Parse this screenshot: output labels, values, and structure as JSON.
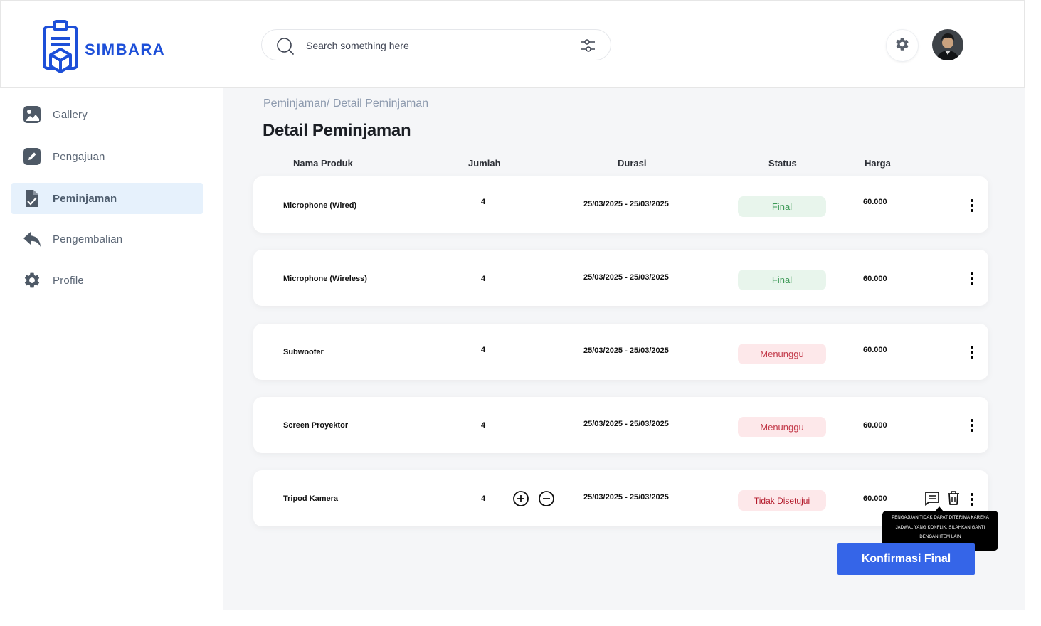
{
  "app": {
    "name": "SIMBARA"
  },
  "search": {
    "placeholder": "Search something here"
  },
  "sidebar": {
    "items": [
      {
        "label": "Gallery",
        "icon": "image-icon"
      },
      {
        "label": "Pengajuan",
        "icon": "edit-icon"
      },
      {
        "label": "Peminjaman",
        "icon": "document-check-icon",
        "active": true
      },
      {
        "label": "Pengembalian",
        "icon": "reply-icon"
      },
      {
        "label": "Profile",
        "icon": "gear-icon"
      }
    ]
  },
  "main": {
    "breadcrumb": "Peminjaman/ Detail Peminjaman",
    "title": "Detail Peminjaman",
    "columns": {
      "name": "Nama Produk",
      "qty": "Jumlah",
      "duration": "Durasi",
      "status": "Status",
      "price": "Harga"
    },
    "rows": [
      {
        "name": "Microphone (Wired)",
        "qty": "4",
        "duration": "25/03/2025 - 25/03/2025",
        "status": "Final",
        "price": "60.000"
      },
      {
        "name": "Microphone (Wireless)",
        "qty": "4",
        "duration": "25/03/2025 - 25/03/2025",
        "status": "Final",
        "price": "60.000"
      },
      {
        "name": "Subwoofer",
        "qty": "4",
        "duration": "25/03/2025 - 25/03/2025",
        "status": "Menunggu",
        "price": "60.000"
      },
      {
        "name": "Screen Proyektor",
        "qty": "4",
        "duration": "25/03/2025 - 25/03/2025",
        "status": "Menunggu",
        "price": "60.000"
      },
      {
        "name": "Tripod Kamera",
        "qty": "4",
        "duration": "25/03/2025 - 25/03/2025",
        "status": "Tidak Disetujui",
        "price": "60.000"
      }
    ],
    "tooltip": "PENGAJUAN TIDAK DAPAT DITERIMA KARENA JADWAL YANG KONFLIK, SILAHKAN GANTI DENGAN ITEM LAIN",
    "confirm_label": "Konfirmasi Final"
  },
  "colors": {
    "brand": "#1d4fd8",
    "accent": "#3565e8",
    "final": "#3d9a57",
    "waiting": "#c33a4a"
  }
}
